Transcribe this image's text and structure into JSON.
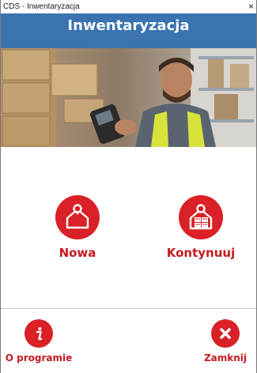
{
  "window": {
    "title": "CDS - Inwentaryzacja",
    "close_glyph": "×"
  },
  "header": {
    "title": "Inwentaryzacja"
  },
  "banner": {
    "description_icon": "warehouse-worker-photo"
  },
  "actions": {
    "nowa": {
      "label": "Nowa",
      "icon": "home-icon"
    },
    "kontynuuj": {
      "label": "Kontynuuj",
      "icon": "warehouse-boxes-icon"
    }
  },
  "footer": {
    "about": {
      "label": "O programie",
      "icon": "info-icon"
    },
    "close": {
      "label": "Zamknij",
      "icon": "close-x-icon"
    }
  },
  "colors": {
    "accent_red": "#d92127",
    "header_blue": "#3b73b0"
  }
}
